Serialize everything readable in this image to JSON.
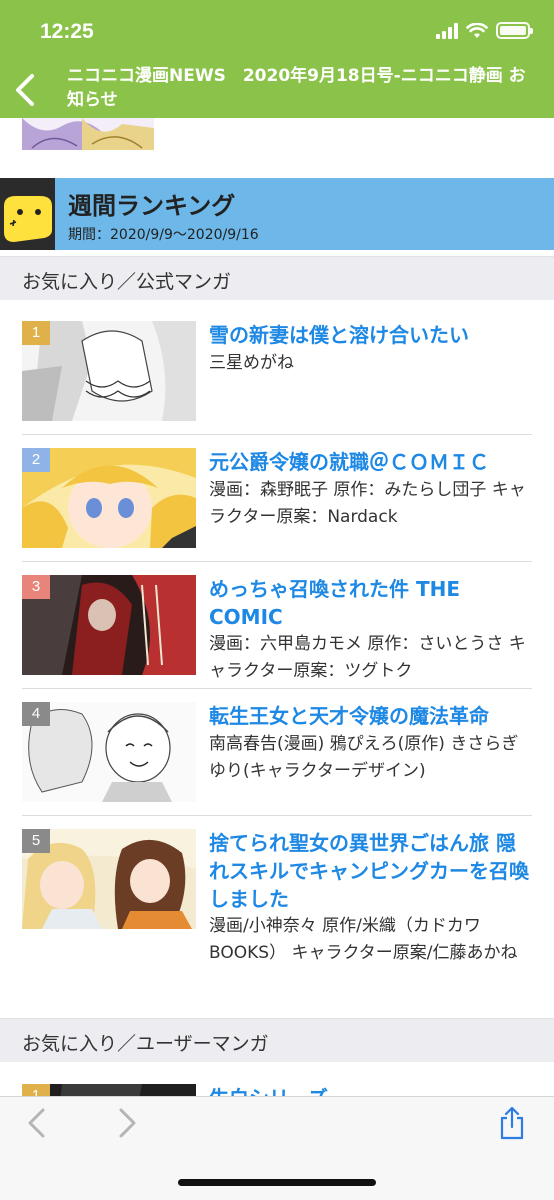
{
  "status_bar": {
    "time": "12:25"
  },
  "header": {
    "title": "ニコニコ漫画NEWS　2020年9月18日号-ニコニコ静画 お知らせ"
  },
  "ranking": {
    "title": "週間ランキング",
    "period": "期間：2020/9/9〜2020/9/16"
  },
  "sections": [
    {
      "label": "お気に入り／公式マンガ"
    },
    {
      "label": "お気に入り／ユーザーマンガ"
    }
  ],
  "items": [
    {
      "rank": "1",
      "title": "雪の新妻は僕と溶け合いたい",
      "author": "三星めがね",
      "badge_color": "#e0b04a"
    },
    {
      "rank": "2",
      "title": "元公爵令嬢の就職＠ＣＯＭＩＣ",
      "author": "漫画：森野眠子 原作：みたらし団子 キャラクター原案：Nardack",
      "badge_color": "#8fb3e6"
    },
    {
      "rank": "3",
      "title": "めっちゃ召喚された件 THE COMIC",
      "author": "漫画：六甲島カモメ 原作：さいとうさ キャラクター原案：ツグトク",
      "badge_color": "#e8857a"
    },
    {
      "rank": "4",
      "title": "転生王女と天才令嬢の魔法革命",
      "author": "南高春告(漫画) 鴉ぴえろ(原作) きさらぎゆり(キャラクターデザイン)",
      "badge_color": "#8a8a8a"
    },
    {
      "rank": "5",
      "title": "捨てられ聖女の異世界ごはん旅 隠れスキルでキャンピングカーを召喚しました",
      "author": "漫画/小神奈々 原作/米織（カドカワBOOKS） キャラクター原案/仁藤あかね",
      "badge_color": "#8a8a8a"
    },
    {
      "rank": "1",
      "title": "生白シリーズ",
      "badge_color": "#e0b04a"
    }
  ],
  "icons": {
    "back": "chevron-left-icon",
    "browser_back": "chevron-left-icon",
    "browser_forward": "chevron-right-icon",
    "share": "share-icon",
    "mascot": "niconico-mascot-icon"
  },
  "colors": {
    "header_green": "#8bc34a",
    "ranking_blue": "#6db8e8",
    "title_link": "#1e88e5"
  }
}
